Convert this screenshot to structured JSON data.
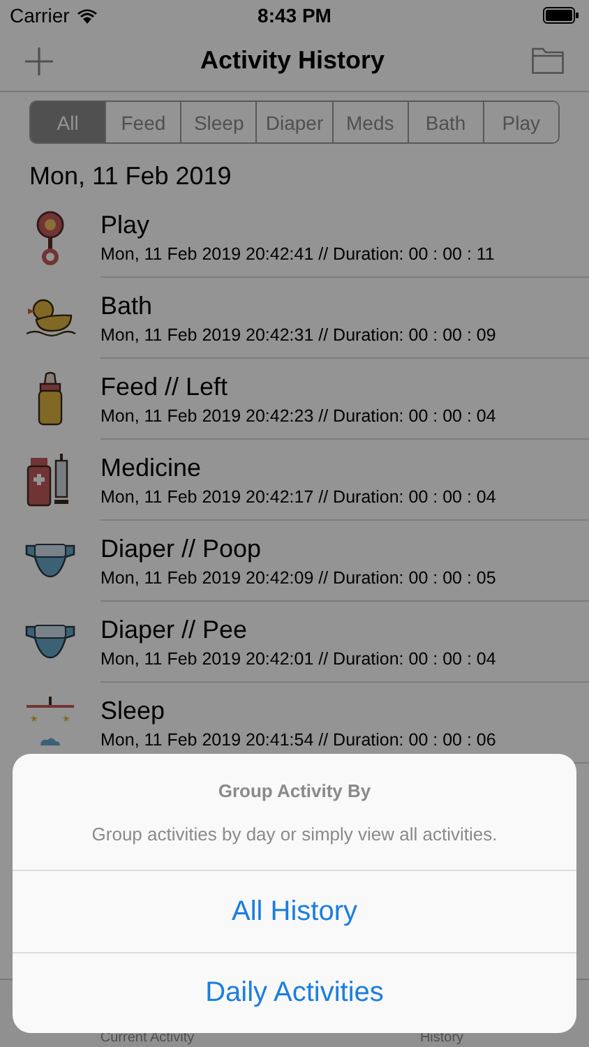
{
  "status_bar": {
    "carrier": "Carrier",
    "time": "8:43 PM"
  },
  "nav_bar": {
    "title": "Activity History"
  },
  "segments": [
    {
      "label": "All",
      "selected": true
    },
    {
      "label": "Feed",
      "selected": false
    },
    {
      "label": "Sleep",
      "selected": false
    },
    {
      "label": "Diaper",
      "selected": false
    },
    {
      "label": "Meds",
      "selected": false
    },
    {
      "label": "Bath",
      "selected": false
    },
    {
      "label": "Play",
      "selected": false
    }
  ],
  "section_header": "Mon, 11 Feb 2019",
  "activities": [
    {
      "kind": "play",
      "title": "Play",
      "detail": "Mon, 11 Feb 2019 20:42:41 // Duration: 00 : 00 : 11"
    },
    {
      "kind": "bath",
      "title": "Bath",
      "detail": "Mon, 11 Feb 2019 20:42:31 // Duration: 00 : 00 : 09"
    },
    {
      "kind": "feed",
      "title": "Feed // Left",
      "detail": "Mon, 11 Feb 2019 20:42:23 // Duration: 00 : 00 : 04"
    },
    {
      "kind": "medicine",
      "title": "Medicine",
      "detail": "Mon, 11 Feb 2019 20:42:17 // Duration: 00 : 00 : 04"
    },
    {
      "kind": "diaper",
      "title": "Diaper // Poop",
      "detail": "Mon, 11 Feb 2019 20:42:09 // Duration: 00 : 00 : 05"
    },
    {
      "kind": "diaper",
      "title": "Diaper // Pee",
      "detail": "Mon, 11 Feb 2019 20:42:01 // Duration: 00 : 00 : 04"
    },
    {
      "kind": "sleep",
      "title": "Sleep",
      "detail": "Mon, 11 Feb 2019 20:41:54 // Duration: 00 : 00 : 06"
    }
  ],
  "tab_bar": [
    {
      "label": "Current Activity"
    },
    {
      "label": "History"
    }
  ],
  "action_sheet": {
    "title": "Group Activity By",
    "message": "Group activities by day or simply view all activities.",
    "actions": [
      "All History",
      "Daily Activities"
    ]
  }
}
